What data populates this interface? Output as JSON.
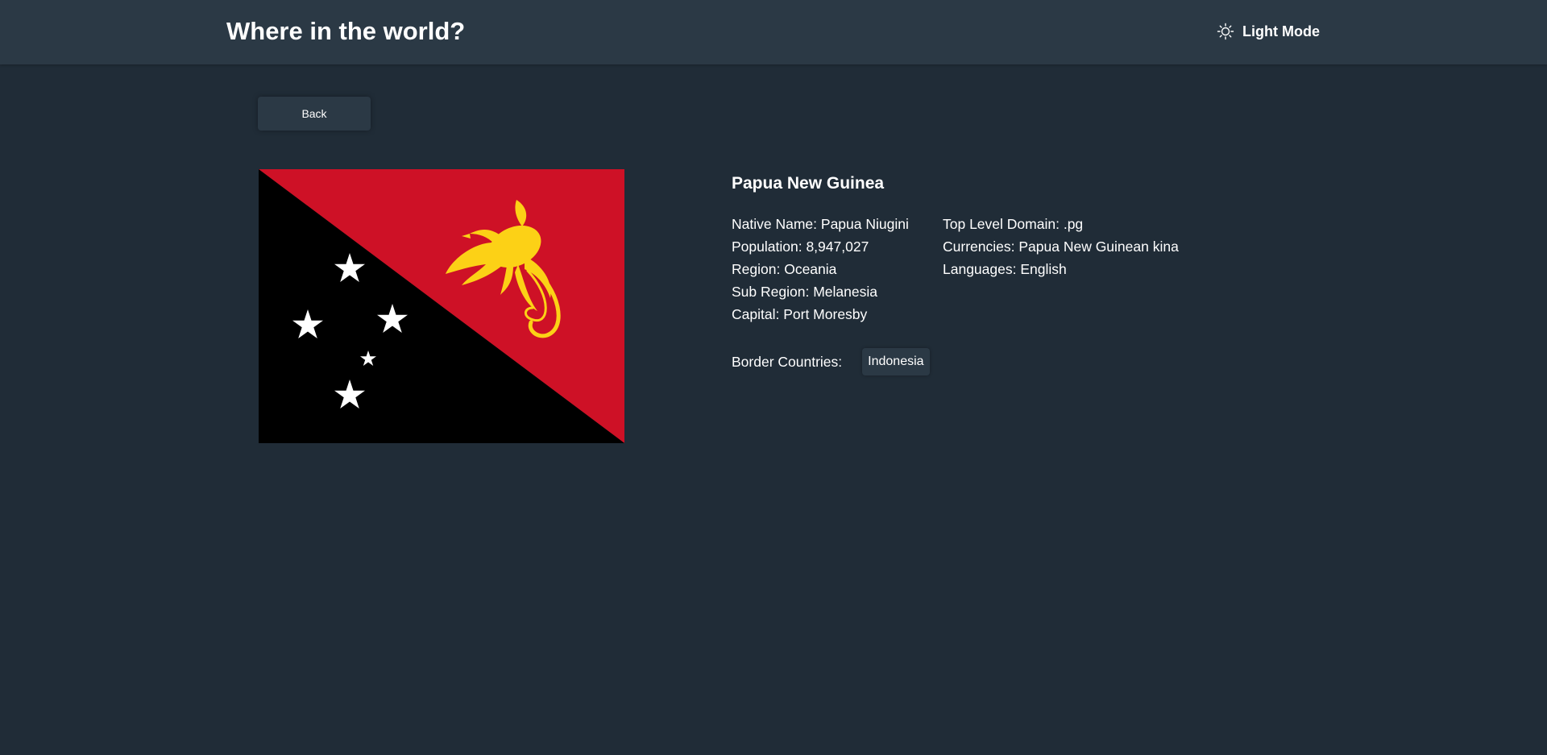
{
  "header": {
    "title": "Where in the world?",
    "mode_toggle": {
      "label": "Light Mode",
      "icon": "sun-icon"
    }
  },
  "back_button": {
    "label": "Back"
  },
  "country": {
    "name": "Papua New Guinea",
    "flag": {
      "icon": "papua-new-guinea-flag",
      "colors": {
        "red": "#ce1126",
        "black": "#000000",
        "gold": "#fcd116",
        "white": "#ffffff"
      }
    },
    "left_rows": [
      {
        "label": "Native Name:",
        "value": "Papua Niugini"
      },
      {
        "label": "Population:",
        "value": "8,947,027"
      },
      {
        "label": "Region:",
        "value": "Oceania"
      },
      {
        "label": "Sub Region:",
        "value": "Melanesia"
      },
      {
        "label": "Capital:",
        "value": "Port Moresby"
      }
    ],
    "right_rows": [
      {
        "label": "Top Level Domain:",
        "value": ".pg"
      },
      {
        "label": "Currencies:",
        "value": "Papua New Guinean kina"
      },
      {
        "label": "Languages:",
        "value": "English"
      }
    ],
    "border_countries_label": "Border Countries:",
    "border_countries": [
      "Indonesia"
    ]
  },
  "theme": {
    "background": "#202c37",
    "element": "#2b3945",
    "text": "#ffffff"
  }
}
